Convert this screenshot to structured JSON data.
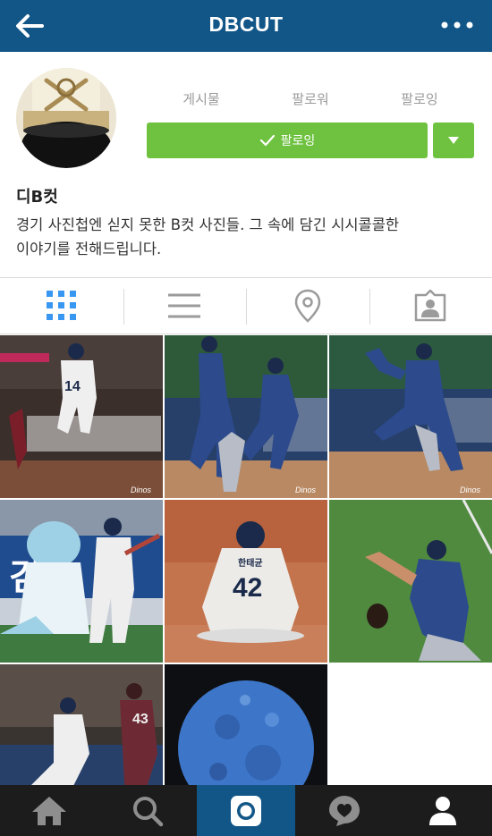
{
  "header": {
    "title": "DBCUT",
    "back_icon": "arrow-left-icon",
    "more_icon": "more-horizontal-icon",
    "bar_color": "#125688"
  },
  "profile": {
    "stats": [
      {
        "label": "게시물"
      },
      {
        "label": "팔로워"
      },
      {
        "label": "팔로잉"
      }
    ],
    "follow_button": {
      "label": "팔로잉",
      "icon": "check-icon",
      "color": "#6fc240"
    },
    "dropdown_icon": "caret-down-icon",
    "name": "디B컷",
    "bio_line1": "경기 사진첩엔 싣지 못한 B컷 사진들. 그 속에 담긴 시시콜콜한",
    "bio_line2": "이야기를 전해드립니다."
  },
  "view_tabs": [
    {
      "name": "grid-view",
      "icon": "grid-icon",
      "active": true,
      "active_color": "#3897f0"
    },
    {
      "name": "list-view",
      "icon": "list-icon"
    },
    {
      "name": "map-view",
      "icon": "location-pin-icon"
    },
    {
      "name": "tagged-view",
      "icon": "tagged-person-icon"
    }
  ],
  "posts": [
    {
      "number": "14",
      "brand": "Dinos"
    },
    {
      "brand": "Dinos"
    },
    {
      "brand": "Dinos"
    },
    {
      "mascot_banner": "김"
    },
    {
      "name": "한태균",
      "number": "42"
    },
    {},
    {
      "number": "43"
    },
    {
      "subject": "full-moon"
    }
  ],
  "bottom_nav": [
    {
      "name": "home",
      "icon": "home-icon"
    },
    {
      "name": "search",
      "icon": "search-icon"
    },
    {
      "name": "camera",
      "icon": "camera-icon",
      "active": true
    },
    {
      "name": "activity",
      "icon": "heart-bubble-icon"
    },
    {
      "name": "profile",
      "icon": "person-icon"
    }
  ]
}
